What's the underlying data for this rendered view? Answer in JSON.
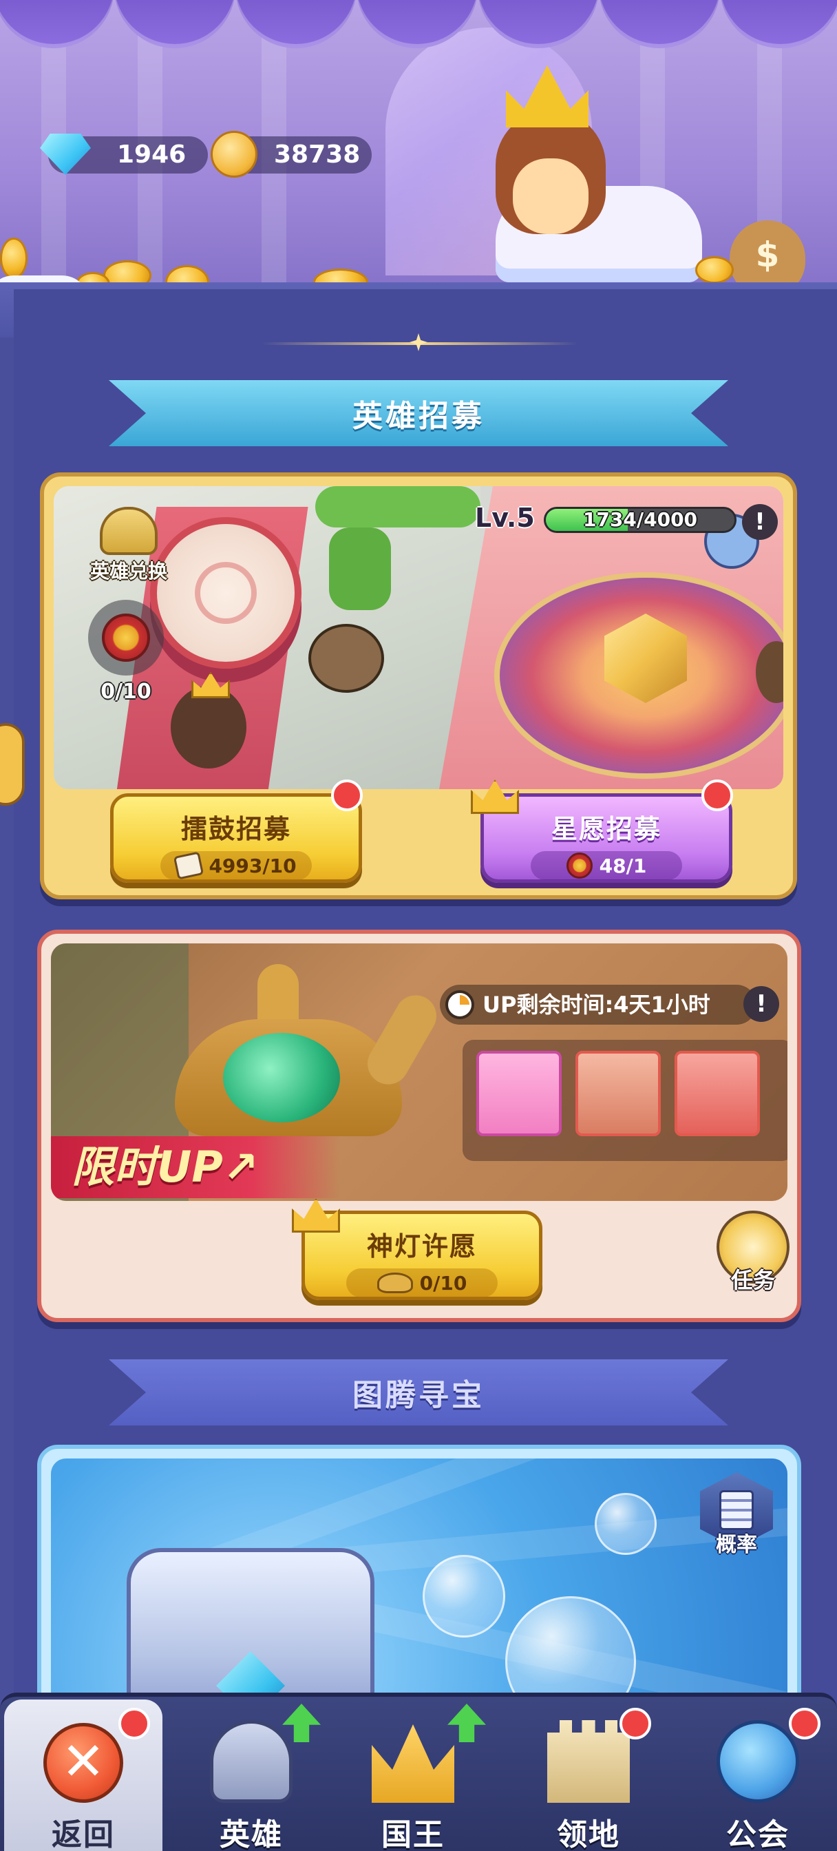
{
  "resources": {
    "diamonds": "1946",
    "gold": "38738"
  },
  "hero_recruit": {
    "section_title": "英雄招募",
    "exchange_label": "英雄兑换",
    "token_count": "0/10",
    "level": "Lv.5",
    "xp_text": "1734/4000",
    "xp_fraction": 0.4335,
    "info_mark": "!",
    "drum_button": {
      "label": "擂鼓招募",
      "cost": "4993/10"
    },
    "star_button": {
      "label": "星愿招募",
      "cost": "48/1"
    }
  },
  "lamp_event": {
    "banner_text": "限时UP↗",
    "timer_text": "UP剩余时间:4天1小时",
    "info_mark": "!",
    "wish_button": {
      "label": "神灯许愿",
      "cost": "0/10"
    },
    "task_label": "任务"
  },
  "totem": {
    "section_title": "图腾寻宝",
    "prob_label": "概率"
  },
  "nav": {
    "back": "返回",
    "hero": "英雄",
    "king": "国王",
    "territory": "领地",
    "guild": "公会"
  },
  "colors": {
    "accent_red": "#ee4242",
    "upgrade_green": "#4ed24f",
    "gold": "#f6cd35",
    "purple": "#c77df0"
  }
}
